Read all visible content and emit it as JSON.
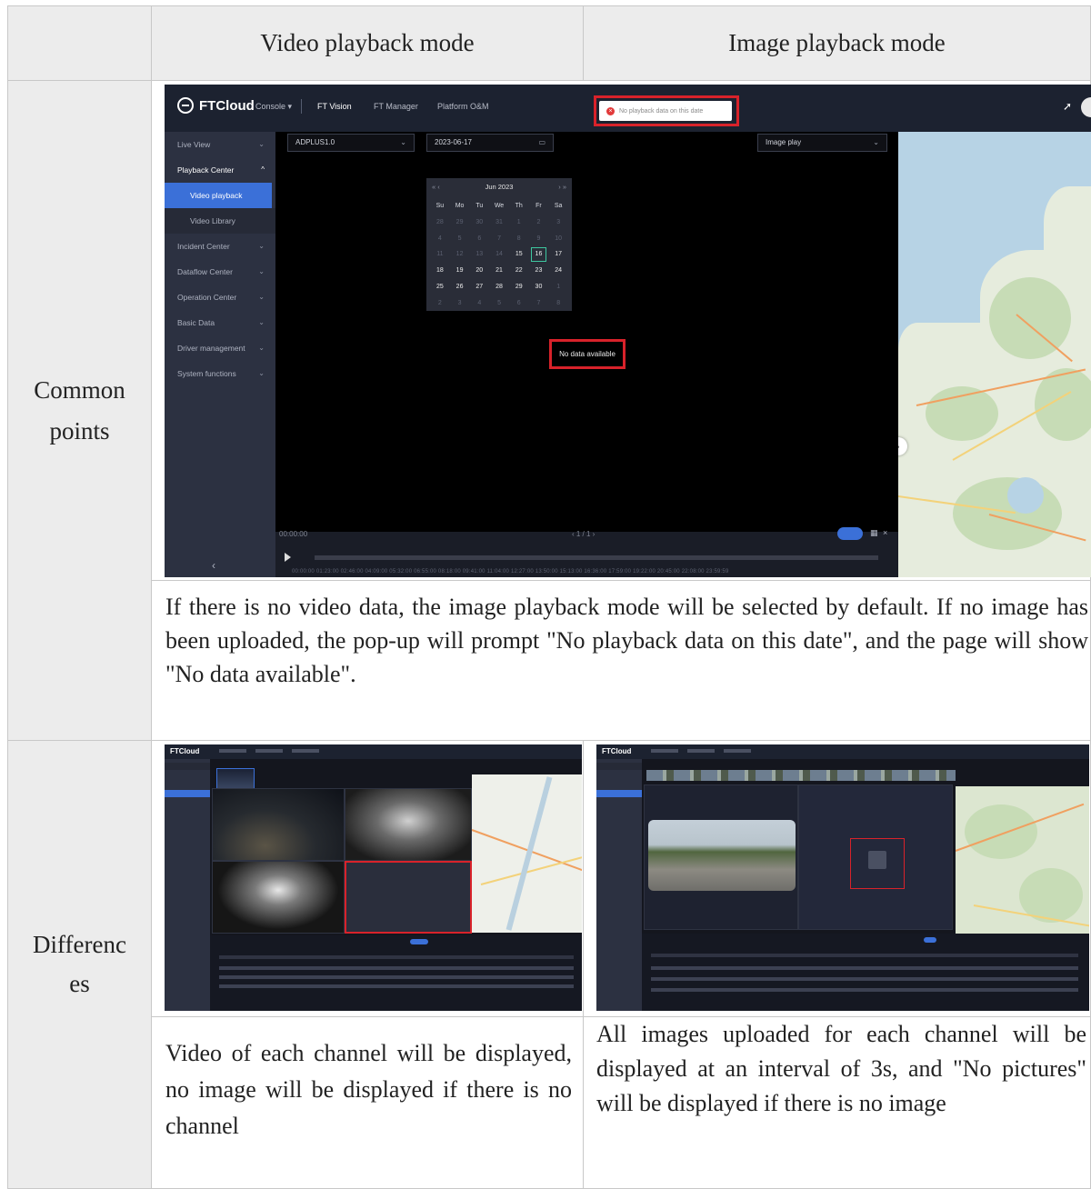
{
  "table": {
    "header": {
      "col1": "Video playback mode",
      "col2": "Image playback mode"
    },
    "rows": [
      {
        "label": "Common points",
        "description": "If there is no video data, the image playback mode will be selected by default. If no image has been uploaded, the pop-up will prompt \"No playback data on this date\", and the page will show \"No data available\"."
      },
      {
        "label": "Differences",
        "video_description": "Video of each channel will be displayed, no image will be displayed if there is no channel",
        "image_description": "All images uploaded for each channel will be displayed at an interval of 3s, and \"No pictures\" will be displayed if there is no image"
      }
    ]
  },
  "screenshot": {
    "brand": "FTCloud",
    "console": "Console ▾",
    "nav": [
      "FT Vision",
      "FT Manager",
      "Platform O&M"
    ],
    "toast": "No playback data on this date",
    "sidebar": [
      {
        "label": "Live View"
      },
      {
        "label": "Playback Center"
      },
      {
        "label": "Video playback"
      },
      {
        "label": "Video Library"
      },
      {
        "label": "Incident Center"
      },
      {
        "label": "Dataflow Center"
      },
      {
        "label": "Operation Center"
      },
      {
        "label": "Basic Data"
      },
      {
        "label": "Driver management"
      },
      {
        "label": "System functions"
      }
    ],
    "device": "ADPLUS1.0",
    "date": "2023-06-17",
    "mode": "Image play",
    "calendar": {
      "month": "Jun  2023",
      "weekdays": [
        "Su",
        "Mo",
        "Tu",
        "We",
        "Th",
        "Fr",
        "Sa"
      ],
      "weeks": [
        [
          "28",
          "29",
          "30",
          "31",
          "1",
          "2",
          "3"
        ],
        [
          "4",
          "5",
          "6",
          "7",
          "8",
          "9",
          "10"
        ],
        [
          "11",
          "12",
          "13",
          "14",
          "15",
          "16",
          "17"
        ],
        [
          "18",
          "19",
          "20",
          "21",
          "22",
          "23",
          "24"
        ],
        [
          "25",
          "26",
          "27",
          "28",
          "29",
          "30",
          "1"
        ],
        [
          "2",
          "3",
          "4",
          "5",
          "6",
          "7",
          "8"
        ]
      ],
      "selected": "16"
    },
    "no_data": "No data available",
    "time": "00:00:00",
    "pager": "‹  1 / 1  ›",
    "ticks": "00:00:00  01:23:00  02:46:00  04:09:00  05:32:00  06:55:00  08:18:00  09:41:00  11:04:00  12:27:00  13:50:00  15:13:00  16:36:00  17:59:00  19:22:00  20:45:00  22:08:00        23:59:59",
    "mini_brand": "FTCloud"
  },
  "colors": {
    "accent": "#3b70d8",
    "highlight": "#d8222a",
    "header_bg": "#ececec"
  },
  "icons": [
    "logo-icon",
    "error-icon",
    "rocket-icon",
    "user-avatar-icon",
    "calendar-icon",
    "chevron-down-icon",
    "play-icon",
    "collapse-icon"
  ]
}
